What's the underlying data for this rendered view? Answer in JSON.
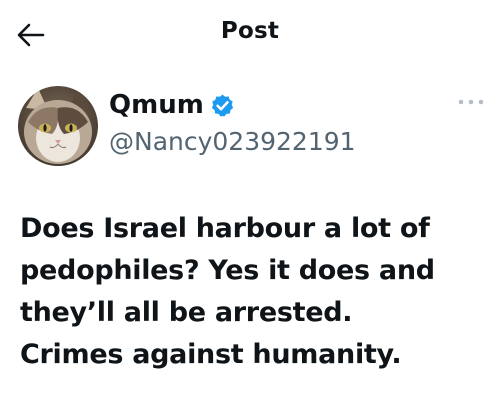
{
  "header": {
    "title": "Post",
    "back_icon": "arrow-left-icon"
  },
  "author": {
    "display_name": "Qmum",
    "handle": "@Nancy023922191",
    "verified": true,
    "verified_color": "#1d9bf0",
    "avatar_icon": "cat-avatar"
  },
  "more_icon": "more-horizontal-icon",
  "post": {
    "text": "Does Israel harbour a lot of\npedophiles?  Yes it does and\nthey’ll all be arrested.\nCrimes against humanity."
  }
}
